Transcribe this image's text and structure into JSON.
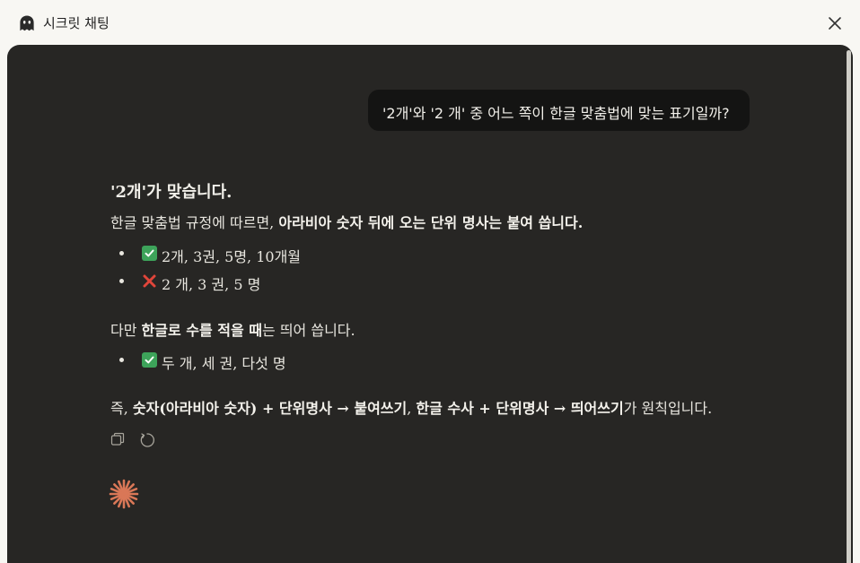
{
  "window": {
    "title": "시크릿 채팅",
    "title_icon": "ghost-icon",
    "close_icon": "close-icon"
  },
  "conversation": {
    "user_message": "'2개'와 '2 개' 중 어느 쪽이 한글 맞춤법에 맞는 표기일까?",
    "answer": {
      "heading": "'2개'가 맞습니다.",
      "rule_prefix": "한글 맞춤법 규정에 따르면, ",
      "rule_bold": "아라비아 숫자 뒤에 오는 단위 명사는 붙여 씁니다.",
      "bullets_numeric": [
        {
          "mark": "check",
          "text": "2개, 3권, 5명, 10개월"
        },
        {
          "mark": "cross",
          "text": "2 개, 3 권, 5 명"
        }
      ],
      "exception_prefix": "다만 ",
      "exception_bold": "한글로 수를 적을 때",
      "exception_suffix": "는 띄어 씁니다.",
      "bullets_korean": [
        {
          "mark": "check",
          "text": "두 개, 세 권, 다섯 명"
        }
      ],
      "summary_prefix": "즉, ",
      "summary_bold1": "숫자(아라비아 숫자) + 단위명사 → 붙여쓰기",
      "summary_mid": ", ",
      "summary_bold2": "한글 수사 + 단위명사 → 띄어쓰기",
      "summary_suffix": "가 원칙입니다."
    },
    "actions": {
      "copy_icon": "copy-icon",
      "retry_icon": "retry-icon"
    },
    "assistant_logo": "spark-icon"
  },
  "colors": {
    "background": "#f8f7f3",
    "panel": "#272624",
    "user_bubble": "#141413",
    "check": "#3da35a",
    "cross": "#e0453a",
    "accent": "#d97757"
  }
}
